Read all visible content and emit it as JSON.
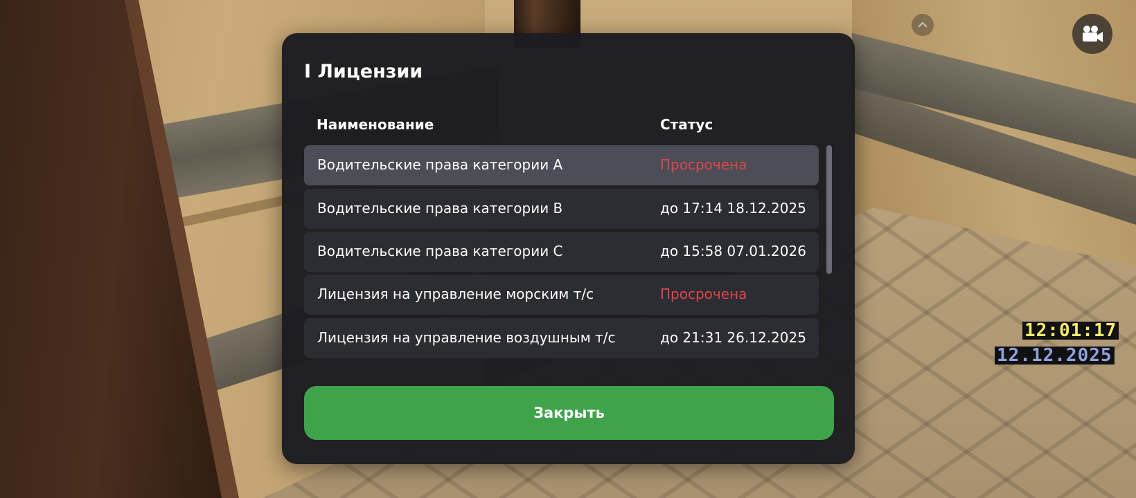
{
  "dialog": {
    "title": "I Лицензии",
    "columns": {
      "name": "Наименование",
      "status": "Статус"
    },
    "rows": [
      {
        "name": "Водительские права категории A",
        "status": "Просрочена",
        "expired": true,
        "selected": true
      },
      {
        "name": "Водительские права категории B",
        "status": "до 17:14 18.12.2025",
        "expired": false,
        "selected": false
      },
      {
        "name": "Водительские права категории C",
        "status": "до 15:58 07.01.2026",
        "expired": false,
        "selected": false
      },
      {
        "name": "Лицензия на управление морским т/с",
        "status": "Просрочена",
        "expired": true,
        "selected": false
      },
      {
        "name": "Лицензия на управление воздушным т/с",
        "status": "до 21:31 26.12.2025",
        "expired": false,
        "selected": false
      }
    ],
    "close_label": "Закрыть"
  },
  "hud": {
    "time": "12:01:17",
    "date": "12.12.2025",
    "icons": {
      "collapse": "chevron-up-icon",
      "camera": "video-camera-icon"
    }
  },
  "colors": {
    "panel": "#1c1c20",
    "row": "#2c2c33",
    "row_selected": "#4c4d56",
    "expired": "#e0454c",
    "accent_button": "#3fa34b",
    "hud_time": "#f4ec6a",
    "hud_date": "#8fa2e0"
  }
}
